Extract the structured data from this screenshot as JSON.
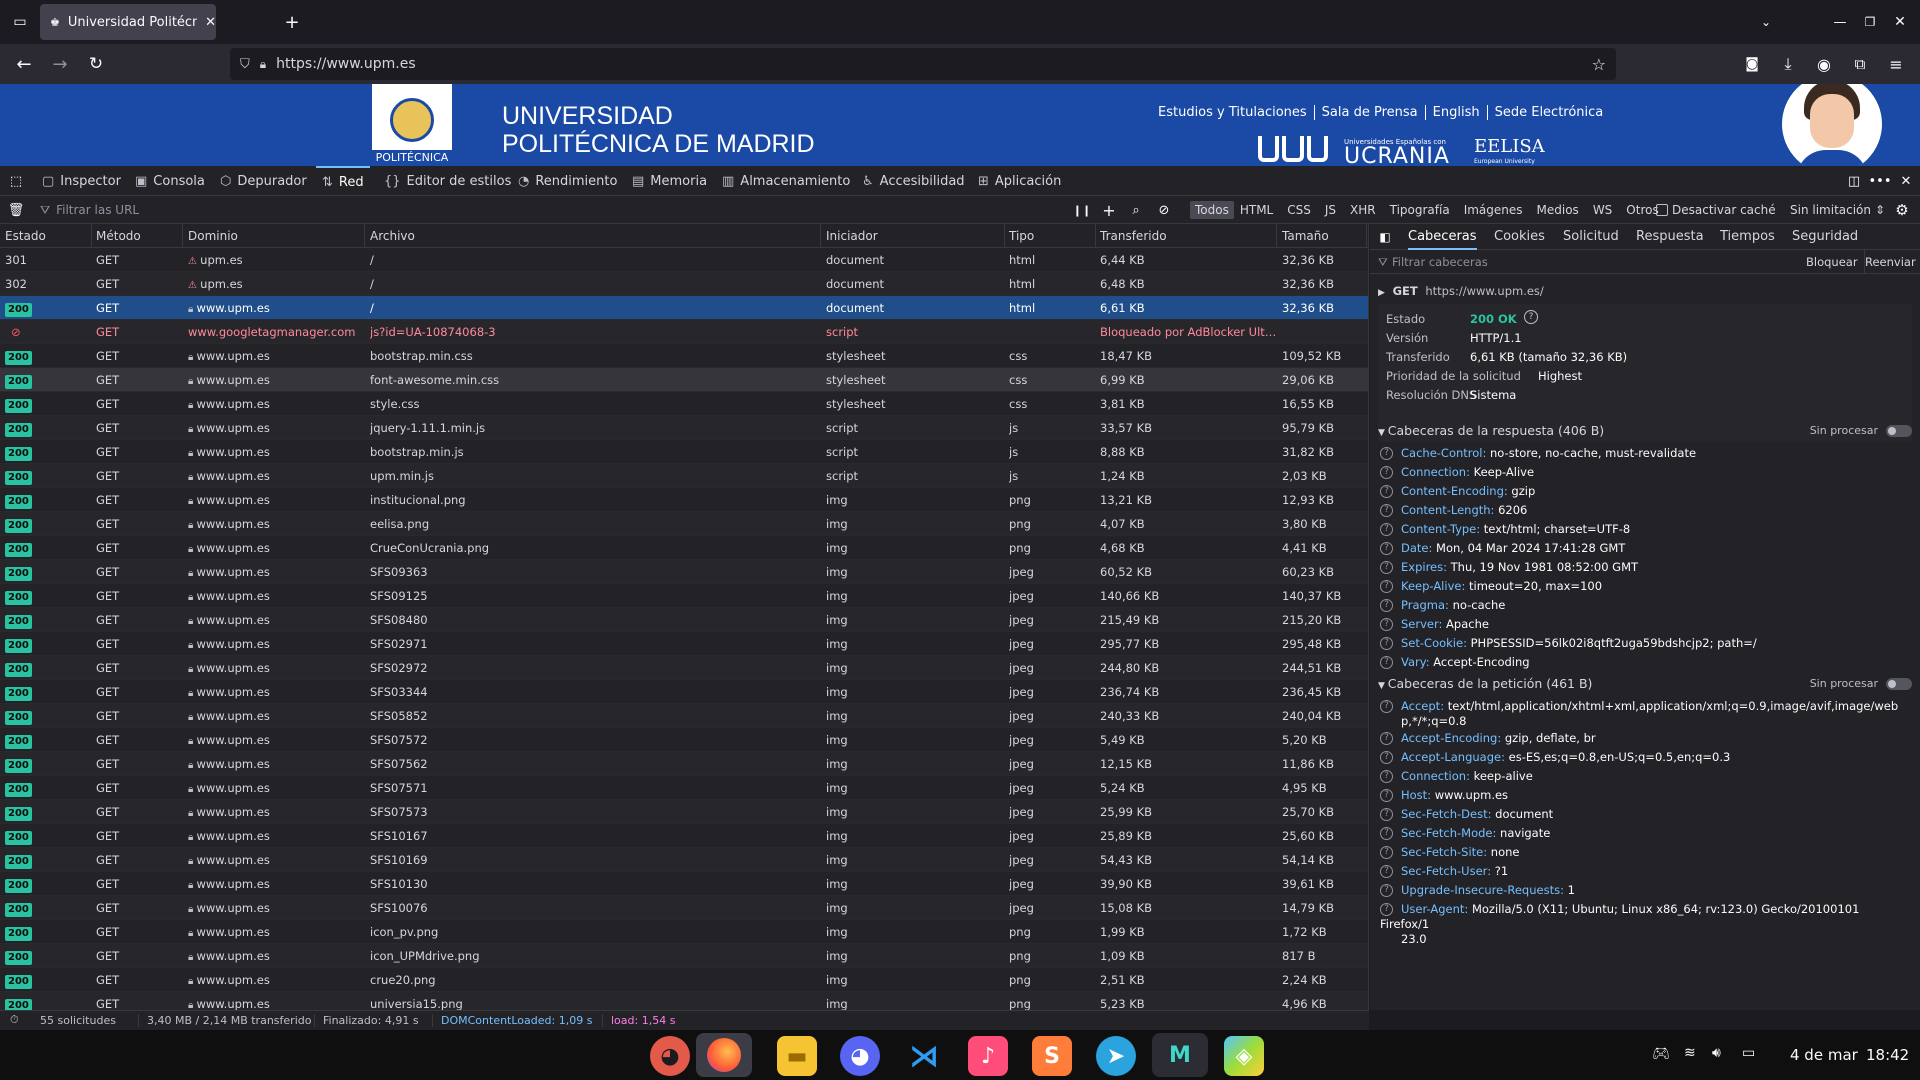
{
  "browser": {
    "tab_title": "Universidad Politécnica d",
    "url": "https://www.upm.es"
  },
  "site": {
    "title_line1": "UNIVERSIDAD",
    "title_line2": "POLITÉCNICA DE MADRID",
    "logo_label": "POLITÉCNICA",
    "links": [
      "Estudios y Titulaciones",
      "Sala de Prensa",
      "English",
      "Sede Electrónica"
    ],
    "ucrania": "UCRANIA",
    "ucrania_small": "Universidades Españolas con",
    "eelisa": "EELISA",
    "eelisa_small": "European University"
  },
  "devtools": {
    "tabs": [
      "Inspector",
      "Consola",
      "Depurador",
      "Red",
      "Editor de estilos",
      "Rendimiento",
      "Memoria",
      "Almacenamiento",
      "Accesibilidad",
      "Aplicación"
    ],
    "selected_tab": "Red"
  },
  "netbar": {
    "filter_placeholder": "Filtrar las URL",
    "types": [
      "Todos",
      "HTML",
      "CSS",
      "JS",
      "XHR",
      "Tipografía",
      "Imágenes",
      "Medios",
      "WS",
      "Otros"
    ],
    "selected_type": "Todos",
    "disable_cache": "Desactivar caché",
    "throttle": "Sin limitación"
  },
  "columns": [
    "Estado",
    "Método",
    "Dominio",
    "Archivo",
    "Iniciador",
    "Tipo",
    "Transferido",
    "Tamaño"
  ],
  "rows": [
    [
      "301",
      "GET",
      "upm.es",
      "/",
      "document",
      "html",
      "6,44 KB",
      "32,36 KB"
    ],
    [
      "302",
      "GET",
      "upm.es",
      "/",
      "document",
      "html",
      "6,48 KB",
      "32,36 KB"
    ],
    [
      "200",
      "GET",
      "www.upm.es",
      "/",
      "document",
      "html",
      "6,61 KB",
      "32,36 KB"
    ],
    [
      "",
      "GET",
      "www.googletagmanager.com",
      "js?id=UA-10874068-3",
      "script",
      "",
      "Bloqueado por AdBlocker Ulti…",
      ""
    ],
    [
      "200",
      "GET",
      "www.upm.es",
      "bootstrap.min.css",
      "stylesheet",
      "css",
      "18,47 KB",
      "109,52 KB"
    ],
    [
      "200",
      "GET",
      "www.upm.es",
      "font-awesome.min.css",
      "stylesheet",
      "css",
      "6,99 KB",
      "29,06 KB"
    ],
    [
      "200",
      "GET",
      "www.upm.es",
      "style.css",
      "stylesheet",
      "css",
      "3,81 KB",
      "16,55 KB"
    ],
    [
      "200",
      "GET",
      "www.upm.es",
      "jquery-1.11.1.min.js",
      "script",
      "js",
      "33,57 KB",
      "95,79 KB"
    ],
    [
      "200",
      "GET",
      "www.upm.es",
      "bootstrap.min.js",
      "script",
      "js",
      "8,88 KB",
      "31,82 KB"
    ],
    [
      "200",
      "GET",
      "www.upm.es",
      "upm.min.js",
      "script",
      "js",
      "1,24 KB",
      "2,03 KB"
    ],
    [
      "200",
      "GET",
      "www.upm.es",
      "institucional.png",
      "img",
      "png",
      "13,21 KB",
      "12,93 KB"
    ],
    [
      "200",
      "GET",
      "www.upm.es",
      "eelisa.png",
      "img",
      "png",
      "4,07 KB",
      "3,80 KB"
    ],
    [
      "200",
      "GET",
      "www.upm.es",
      "CrueConUcrania.png",
      "img",
      "png",
      "4,68 KB",
      "4,41 KB"
    ],
    [
      "200",
      "GET",
      "www.upm.es",
      "SFS09363",
      "img",
      "jpeg",
      "60,52 KB",
      "60,23 KB"
    ],
    [
      "200",
      "GET",
      "www.upm.es",
      "SFS09125",
      "img",
      "jpeg",
      "140,66 KB",
      "140,37 KB"
    ],
    [
      "200",
      "GET",
      "www.upm.es",
      "SFS08480",
      "img",
      "jpeg",
      "215,49 KB",
      "215,20 KB"
    ],
    [
      "200",
      "GET",
      "www.upm.es",
      "SFS02971",
      "img",
      "jpeg",
      "295,77 KB",
      "295,48 KB"
    ],
    [
      "200",
      "GET",
      "www.upm.es",
      "SFS02972",
      "img",
      "jpeg",
      "244,80 KB",
      "244,51 KB"
    ],
    [
      "200",
      "GET",
      "www.upm.es",
      "SFS03344",
      "img",
      "jpeg",
      "236,74 KB",
      "236,45 KB"
    ],
    [
      "200",
      "GET",
      "www.upm.es",
      "SFS05852",
      "img",
      "jpeg",
      "240,33 KB",
      "240,04 KB"
    ],
    [
      "200",
      "GET",
      "www.upm.es",
      "SFS07572",
      "img",
      "jpeg",
      "5,49 KB",
      "5,20 KB"
    ],
    [
      "200",
      "GET",
      "www.upm.es",
      "SFS07562",
      "img",
      "jpeg",
      "12,15 KB",
      "11,86 KB"
    ],
    [
      "200",
      "GET",
      "www.upm.es",
      "SFS07571",
      "img",
      "jpeg",
      "5,24 KB",
      "4,95 KB"
    ],
    [
      "200",
      "GET",
      "www.upm.es",
      "SFS07573",
      "img",
      "jpeg",
      "25,99 KB",
      "25,70 KB"
    ],
    [
      "200",
      "GET",
      "www.upm.es",
      "SFS10167",
      "img",
      "jpeg",
      "25,89 KB",
      "25,60 KB"
    ],
    [
      "200",
      "GET",
      "www.upm.es",
      "SFS10169",
      "img",
      "jpeg",
      "54,43 KB",
      "54,14 KB"
    ],
    [
      "200",
      "GET",
      "www.upm.es",
      "SFS10130",
      "img",
      "jpeg",
      "39,90 KB",
      "39,61 KB"
    ],
    [
      "200",
      "GET",
      "www.upm.es",
      "SFS10076",
      "img",
      "jpeg",
      "15,08 KB",
      "14,79 KB"
    ],
    [
      "200",
      "GET",
      "www.upm.es",
      "icon_pv.png",
      "img",
      "png",
      "1,99 KB",
      "1,72 KB"
    ],
    [
      "200",
      "GET",
      "www.upm.es",
      "icon_UPMdrive.png",
      "img",
      "png",
      "1,09 KB",
      "817 B"
    ],
    [
      "200",
      "GET",
      "www.upm.es",
      "crue20.png",
      "img",
      "png",
      "2,51 KB",
      "2,24 KB"
    ],
    [
      "200",
      "GET",
      "www.upm.es",
      "universia15.png",
      "img",
      "png",
      "5,23 KB",
      "4,96 KB"
    ]
  ],
  "selected_row": 2,
  "status": {
    "requests": "55 solicitudes",
    "transferred": "3,40 MB / 2,14 MB transferido",
    "finished": "Finalizado: 4,91 s",
    "dcl": "DOMContentLoaded: 1,09 s",
    "load": "load: 1,54 s"
  },
  "side": {
    "tabs": [
      "Cabeceras",
      "Cookies",
      "Solicitud",
      "Respuesta",
      "Tiempos",
      "Seguridad"
    ],
    "selected_tab": "Cabeceras",
    "filter_placeholder": "Filtrar cabeceras",
    "block": "Bloquear",
    "resend": "Reenviar",
    "request_line": "GET",
    "request_url": "https://www.upm.es/",
    "summary": [
      [
        "Estado",
        "200 OK"
      ],
      [
        "Versión",
        "HTTP/1.1"
      ],
      [
        "Transferido",
        "6,61 KB (tamaño 32,36 KB)"
      ],
      [
        "Prioridad de la solicitud",
        "Highest"
      ],
      [
        "Resolución DNS",
        "Sistema"
      ]
    ],
    "response_section": "Cabeceras de la respuesta (406 B)",
    "raw_label": "Sin procesar",
    "response_headers": [
      [
        "Cache-Control:",
        "no-store, no-cache, must-revalidate"
      ],
      [
        "Connection:",
        "Keep-Alive"
      ],
      [
        "Content-Encoding:",
        "gzip"
      ],
      [
        "Content-Length:",
        "6206"
      ],
      [
        "Content-Type:",
        "text/html; charset=UTF-8"
      ],
      [
        "Date:",
        "Mon, 04 Mar 2024 17:41:28 GMT"
      ],
      [
        "Expires:",
        "Thu, 19 Nov 1981 08:52:00 GMT"
      ],
      [
        "Keep-Alive:",
        "timeout=20, max=100"
      ],
      [
        "Pragma:",
        "no-cache"
      ],
      [
        "Server:",
        "Apache"
      ],
      [
        "Set-Cookie:",
        "PHPSESSID=56lk02i8qtft2uga59bdshcjp2; path=/"
      ],
      [
        "Vary:",
        "Accept-Encoding"
      ]
    ],
    "request_section": "Cabeceras de la petición (461 B)",
    "request_headers": [
      [
        "Accept:",
        "text/html,application/xhtml+xml,application/xml;q=0.9,image/avif,image/web",
        "p,*/*;q=0.8"
      ],
      [
        "Accept-Encoding:",
        "gzip, deflate, br",
        ""
      ],
      [
        "Accept-Language:",
        "es-ES,es;q=0.8,en-US;q=0.5,en;q=0.3",
        ""
      ],
      [
        "Connection:",
        "keep-alive",
        ""
      ],
      [
        "Host:",
        "www.upm.es",
        ""
      ],
      [
        "Sec-Fetch-Dest:",
        "document",
        ""
      ],
      [
        "Sec-Fetch-Mode:",
        "navigate",
        ""
      ],
      [
        "Sec-Fetch-Site:",
        "none",
        ""
      ],
      [
        "Sec-Fetch-User:",
        "?1",
        ""
      ],
      [
        "Upgrade-Insecure-Requests:",
        "1",
        ""
      ],
      [
        "User-Agent:",
        "Mozilla/5.0 (X11; Ubuntu; Linux x86_64; rv:123.0) Gecko/20100101 Firefox/1",
        "23.0"
      ]
    ]
  },
  "taskbar": {
    "date": "4 de mar",
    "time": "18:42",
    "apps": [
      "openshot-icon",
      "firefox-icon",
      "files-icon",
      "discord-icon",
      "vscode-icon",
      "music-icon",
      "sublime-icon",
      "telegram-icon",
      "mail-icon",
      "box-icon"
    ]
  }
}
